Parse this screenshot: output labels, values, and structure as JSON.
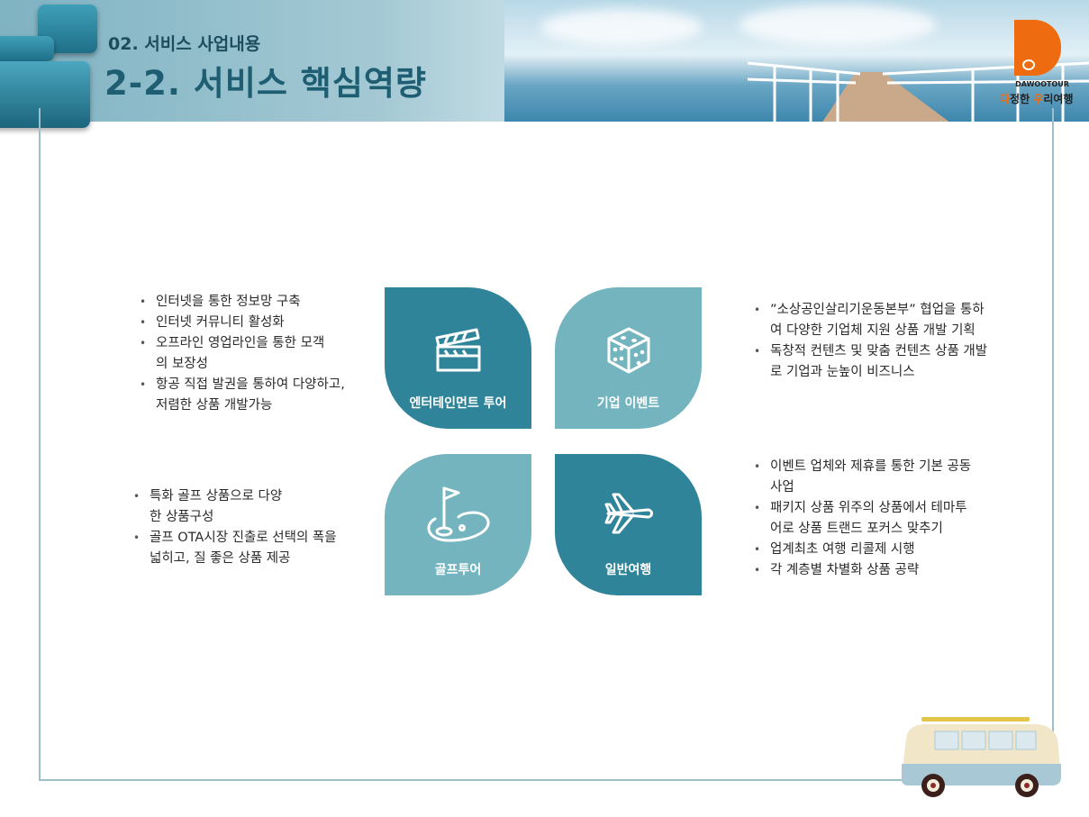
{
  "header": {
    "subtitle": "02. 서비스 사업내용",
    "title": "2-2. 서비스 핵심역량"
  },
  "logo": {
    "brand_en": "DAWOOTOUR",
    "slogan": {
      "part1": "다",
      "part2": "정한 ",
      "part3": "우",
      "part4": "리여행"
    },
    "accent_color": "#ee6b10"
  },
  "colors": {
    "tile_dark": "#2f8499",
    "tile_light": "#74b4bf",
    "frame": "#9dbfca"
  },
  "tiles": [
    {
      "label": "엔터테인먼트 투어",
      "icon": "clapperboard-icon"
    },
    {
      "label": "기업 이벤트",
      "icon": "dice-icon"
    },
    {
      "label": "골프투어",
      "icon": "golf-flag-icon"
    },
    {
      "label": "일반여행",
      "icon": "airplane-icon"
    }
  ],
  "lists": {
    "top_left": [
      "인터넷을 통한 정보망 구축",
      "인터넷 커뮤니티 활성화",
      "오프라인 영업라인을 통한 모객의 보장성",
      "항공 직접 발권을 통하여 다양하고, 저렴한 상품 개발가능"
    ],
    "top_right": [
      "”소상공인살리기운동본부” 협업을 통하여 다양한 기업체 지원 상품 개발 기획",
      "독창적 컨텐츠 및 맞춤 컨텐츠 상품 개발로 기업과 눈높이 비즈니스"
    ],
    "bottom_left": [
      "특화 골프 상품으로 다양한 상품구성",
      "골프 OTA시장 진출로 선택의 폭을 넓히고, 질 좋은 상품 제공"
    ],
    "bottom_right": [
      "이벤트 업체와 제휴를 통한 기본 공동 사업",
      "패키지 상품 위주의 상품에서 테마투어로 상품 트랜드 포커스 맞추기",
      "업계최초 여행 리콜제 시행",
      "각 계층별 차별화 상품 공략"
    ]
  }
}
